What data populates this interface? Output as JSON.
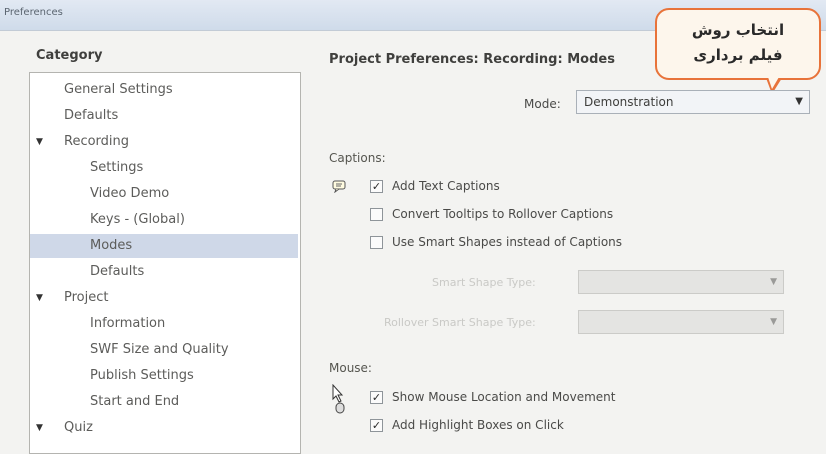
{
  "window": {
    "title": "Preferences"
  },
  "category": {
    "heading": "Category",
    "items": [
      {
        "label": "General Settings",
        "indent": 1,
        "arrow": ""
      },
      {
        "label": "Defaults",
        "indent": 1,
        "arrow": ""
      },
      {
        "label": "Recording",
        "indent": 1,
        "arrow": "▼"
      },
      {
        "label": "Settings",
        "indent": 2,
        "arrow": ""
      },
      {
        "label": "Video Demo",
        "indent": 2,
        "arrow": ""
      },
      {
        "label": "Keys - (Global)",
        "indent": 2,
        "arrow": ""
      },
      {
        "label": "Modes",
        "indent": 2,
        "arrow": "",
        "selected": true
      },
      {
        "label": "Defaults",
        "indent": 2,
        "arrow": ""
      },
      {
        "label": "Project",
        "indent": 1,
        "arrow": "▼"
      },
      {
        "label": "Information",
        "indent": 2,
        "arrow": ""
      },
      {
        "label": "SWF Size and Quality",
        "indent": 2,
        "arrow": ""
      },
      {
        "label": "Publish Settings",
        "indent": 2,
        "arrow": ""
      },
      {
        "label": "Start and End",
        "indent": 2,
        "arrow": ""
      },
      {
        "label": "Quiz",
        "indent": 1,
        "arrow": "▼"
      }
    ]
  },
  "main": {
    "section_title": "Project Preferences: Recording: Modes",
    "mode_label": "Mode:",
    "mode_value": "Demonstration",
    "captions": {
      "label": "Captions:",
      "add_text_captions": "Add Text Captions",
      "convert_tooltips": "Convert Tooltips to Rollover Captions",
      "use_smart_shapes": "Use Smart Shapes instead of Captions",
      "smart_shape_label": "Smart Shape Type:",
      "rollover_label": "Rollover Smart Shape Type:"
    },
    "mouse": {
      "label": "Mouse:",
      "show_mouse": "Show Mouse Location and Movement",
      "add_highlight": "Add Highlight Boxes on Click"
    }
  },
  "callout": {
    "line1": "انتخاب روش",
    "line2": "فیلم برداری"
  },
  "checks": {
    "add_text_captions": true,
    "convert_tooltips": false,
    "use_smart_shapes": false,
    "show_mouse": true,
    "add_highlight": true
  }
}
